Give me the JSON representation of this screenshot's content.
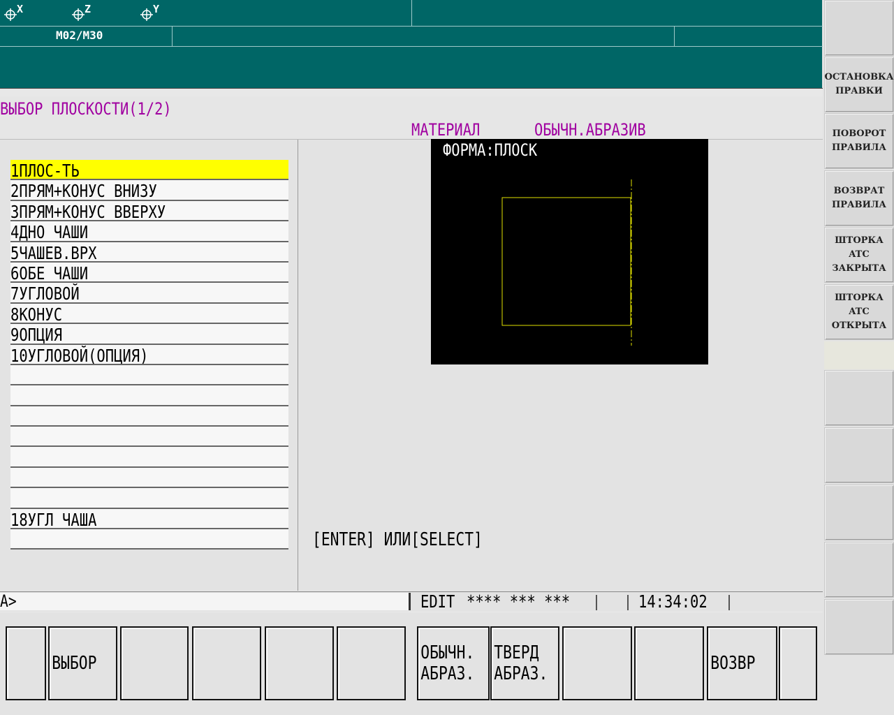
{
  "top_status": {
    "axes": [
      {
        "icon": "axis-crosshair-icon",
        "label": "X"
      },
      {
        "icon": "axis-crosshair-icon",
        "label": "Z"
      },
      {
        "icon": "axis-crosshair-icon",
        "label": "Y"
      }
    ],
    "mcode": "M02/M30"
  },
  "screen": {
    "title": "ВЫБОР ПЛОСКОСТИ(1/2)",
    "material_label": "МАТЕРИАЛ",
    "material_value": "ОБЫЧН.АБРАЗИВ",
    "shape_label": "ФОРМА:ПЛОСК",
    "hint": "[ENTER] ИЛИ[SELECT]"
  },
  "list": {
    "selected_index": 0,
    "items": [
      "1ПЛОС-ТЬ",
      "2ПРЯМ+КОНУС ВНИЗУ",
      "3ПРЯМ+КОНУС ВВЕРХУ",
      "4ДНО ЧАШИ",
      "5ЧАШЕВ.ВРХ",
      "6ОБЕ ЧАШИ",
      "7УГЛОВОЙ",
      "8КОНУС",
      "9ОПЦИЯ",
      "10УГЛОВОЙ(ОПЦИЯ)",
      "",
      "",
      "",
      "",
      "",
      "",
      "",
      "18УГЛ ЧАША",
      ""
    ]
  },
  "status_line": {
    "prompt": "A>",
    "mode": "EDIT",
    "stars": "**** *** ***",
    "time": "14:34:02"
  },
  "softkeys": [
    {
      "label": ""
    },
    {
      "label": "ВЫБОР"
    },
    {
      "label": ""
    },
    {
      "label": ""
    },
    {
      "label": ""
    },
    {
      "label": ""
    },
    {
      "label": "ОБЫЧН.\nАБРАЗ."
    },
    {
      "label": "ТВЕРД\nАБРАЗ."
    },
    {
      "label": ""
    },
    {
      "label": ""
    },
    {
      "label": "ВОЗВР"
    },
    {
      "label": ""
    }
  ],
  "right_keys": [
    {
      "label": ""
    },
    {
      "label": "ОСТАНОВКА\nПРАВКИ"
    },
    {
      "label": "ПОВОРОТ\nПРАВИЛА"
    },
    {
      "label": "ВОЗВРАТ\nПРАВИЛА"
    },
    {
      "label": "ШТОРКА\nATC\nЗАКРЫТА"
    },
    {
      "label": "ШТОРКА\nATC\nОТКРЫТА"
    },
    {
      "label": ""
    },
    {
      "label": ""
    },
    {
      "label": ""
    },
    {
      "label": ""
    },
    {
      "label": ""
    }
  ],
  "colors": {
    "teal": "#006666",
    "magenta": "#a000a0",
    "selected": "#ffff00",
    "wheel_outline": "#e0e000"
  }
}
